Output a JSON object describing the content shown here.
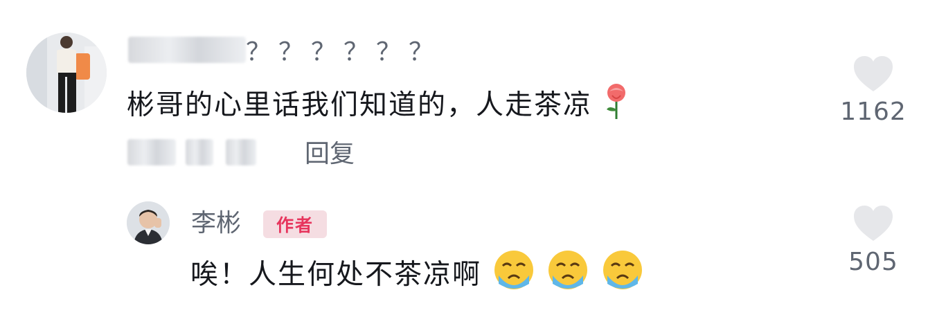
{
  "comment": {
    "username_visible": "？？？？？？",
    "text": "彬哥的心里话我们知道的，人走茶凉",
    "reply_label": "回复",
    "like_count": "1162",
    "emoji": "rose-emoji"
  },
  "reply": {
    "author": "李彬",
    "badge": "作者",
    "text": "唉！人生何处不茶凉啊",
    "like_count": "505",
    "emojis": [
      "crying-face-emoji",
      "crying-face-emoji",
      "crying-face-emoji"
    ]
  },
  "colors": {
    "text_primary": "#16181d",
    "text_secondary": "#5f6672",
    "badge_bg": "#f5dde2",
    "badge_text": "#e7355d",
    "like_icon": "#e6e7ea"
  }
}
